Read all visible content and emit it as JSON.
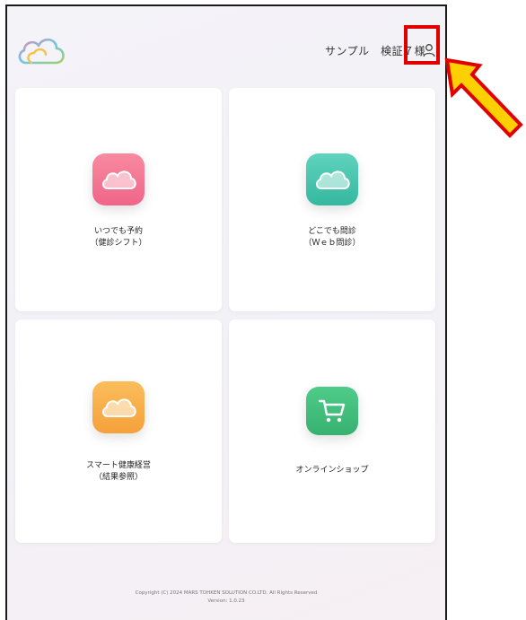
{
  "header": {
    "user_name": "サンプル　検証７様",
    "user_icon": "user-icon"
  },
  "menu": [
    {
      "id": "reserve",
      "line1": "いつでも予約",
      "line2": "（健診シフト）",
      "icon": "cloud-icon",
      "color": "#ef6f8e"
    },
    {
      "id": "consult",
      "line1": "どこでも問診",
      "line2": "（Ｗｅｂ問診）",
      "icon": "cloud-icon",
      "color": "#3fc1a9"
    },
    {
      "id": "smart",
      "line1": "スマート健康経営",
      "line2": "（結果参照）",
      "icon": "cloud-icon",
      "color": "#f6a942"
    },
    {
      "id": "shop",
      "line1": "オンラインショップ",
      "line2": "",
      "icon": "cart-icon",
      "color": "#3dba78"
    }
  ],
  "footer": {
    "copyright": "Copyright (C) 2024 MARS TOHKEN SOLUTION CO.LTD. All Rights Reserved",
    "version": "Version: 1.0.23"
  },
  "annotation": {
    "highlight_color": "#e00000",
    "arrow_color": "#ffd000"
  }
}
